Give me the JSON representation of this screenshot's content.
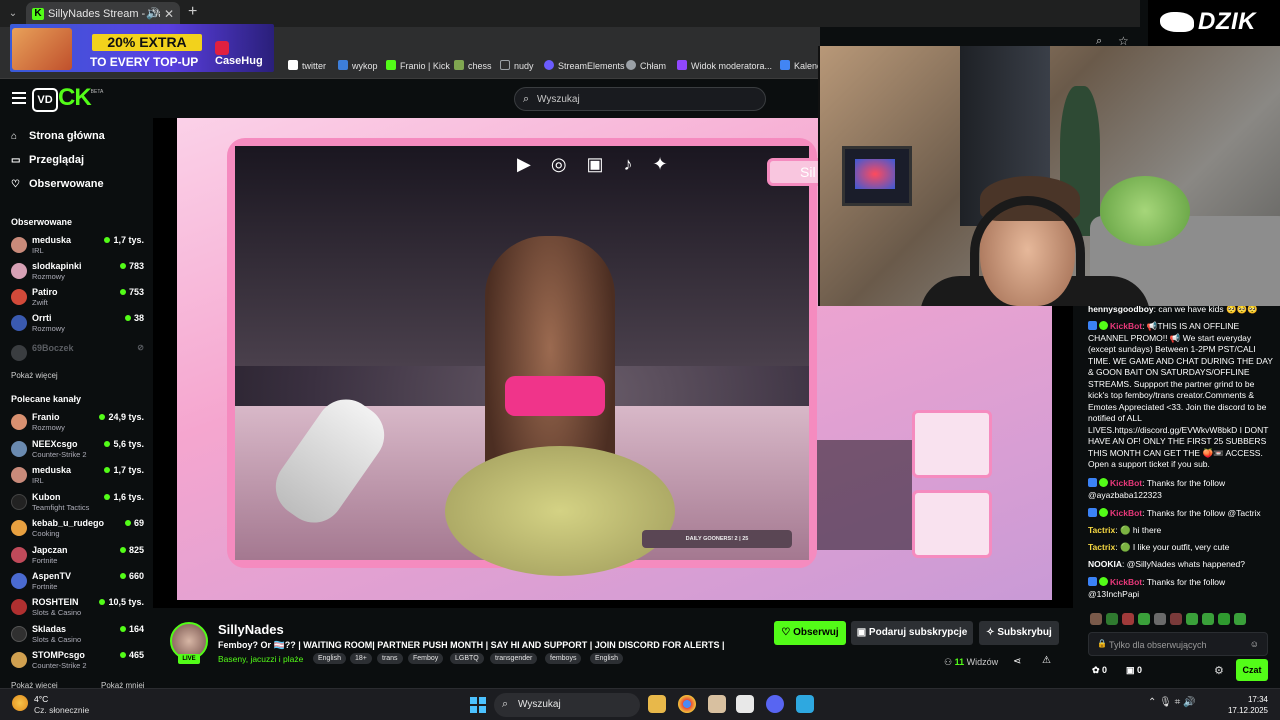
{
  "browser": {
    "tab_title": "SillyNades Stream - Watch L",
    "bookmarks": [
      {
        "label": "twitter",
        "color": "#ffffff"
      },
      {
        "label": "wykop",
        "color": "#3d7ed9"
      },
      {
        "label": "Franio | Kick",
        "color": "#53fc18"
      },
      {
        "label": "chess",
        "color": "#7fa650"
      },
      {
        "label": "nudy",
        "color": "#9aa0a6"
      },
      {
        "label": "StreamElements",
        "color": "#6b5cff"
      },
      {
        "label": "Chłam",
        "color": "#9aa0a6"
      },
      {
        "label": "Widok moderatora...",
        "color": "#9147ff"
      },
      {
        "label": "Kalend",
        "color": "#4285f4"
      }
    ]
  },
  "ad": {
    "headline": "20% EXTRA",
    "subline": "TO EVERY TOP-UP",
    "brand": "CaseHug"
  },
  "header": {
    "logo_badge": "VD",
    "logo_text": "CK",
    "beta": "BETA",
    "search_placeholder": "Wyszukaj"
  },
  "sidebar": {
    "nav": [
      {
        "label": "Strona główna",
        "icon": "home-icon"
      },
      {
        "label": "Przeglądaj",
        "icon": "browse-icon"
      },
      {
        "label": "Obserwowane",
        "icon": "heart-icon"
      }
    ],
    "followed_title": "Obserwowane",
    "followed": [
      {
        "name": "meduska",
        "category": "IRL",
        "viewers": "1,7 tys.",
        "color": "#c98a7a"
      },
      {
        "name": "slodkapinki",
        "category": "Rozmowy",
        "viewers": "783",
        "color": "#d6a0b4"
      },
      {
        "name": "Patiro",
        "category": "Zwift",
        "viewers": "753",
        "color": "#d24a3a"
      },
      {
        "name": "Orrti",
        "category": "Rozmowy",
        "viewers": "38",
        "color": "#3a5ab0"
      },
      {
        "name": "69Boczek",
        "category": "",
        "viewers": "",
        "color": "#3a3d40"
      }
    ],
    "show_more": "Pokaż więcej",
    "recommended_title": "Polecane kanały",
    "recommended": [
      {
        "name": "Franio",
        "category": "Rozmowy",
        "viewers": "24,9 tys.",
        "color": "#d89070"
      },
      {
        "name": "NEEXcsgo",
        "category": "Counter-Strike 2",
        "viewers": "5,6 tys.",
        "color": "#6a8ab0"
      },
      {
        "name": "meduska",
        "category": "IRL",
        "viewers": "1,7 tys.",
        "color": "#c98a7a"
      },
      {
        "name": "Kubon",
        "category": "Teamfight Tactics",
        "viewers": "1,6 tys.",
        "color": "#222222"
      },
      {
        "name": "kebab_u_rudego",
        "category": "Cooking",
        "viewers": "69",
        "color": "#e8a040"
      },
      {
        "name": "Japczan",
        "category": "Fortnite",
        "viewers": "825",
        "color": "#c04a5a"
      },
      {
        "name": "AspenTV",
        "category": "Fortnite",
        "viewers": "660",
        "color": "#4a6ad0"
      },
      {
        "name": "ROSHTEIN",
        "category": "Slots & Casino",
        "viewers": "10,5 tys.",
        "color": "#b03030"
      },
      {
        "name": "Skladas",
        "category": "Slots & Casino",
        "viewers": "164",
        "color": "#303030"
      },
      {
        "name": "STOMPcsgo",
        "category": "Counter-Strike 2",
        "viewers": "465",
        "color": "#d0a050"
      }
    ],
    "footer_more": "Pokaż więcej",
    "footer_less": "Pokaż mniej"
  },
  "video_overlay": {
    "daily_goal": "DAILY GOONERS!    2 | 25",
    "side_label": "Sil"
  },
  "stream": {
    "live": "LIVE",
    "name": "SillyNades",
    "title": "Femboy? Or 🏳️‍⚧️?? | WAITING ROOM|  PARTNER PUSH  MONTH | SAY HI AND SUPPORT | JOIN DISCORD FOR ALERTS |",
    "category": "Baseny, jacuzzi i plaże",
    "tags": [
      "English",
      "18+",
      "trans",
      "Femboy",
      "LGBTQ",
      "transgender",
      "femboys",
      "English"
    ],
    "follow_label": "Obserwuj",
    "gift_label": "Podaruj subskrypcje",
    "subscribe_label": "Subskrybuj",
    "viewer_count": "11",
    "viewer_label": "Widzów"
  },
  "chat": {
    "messages": [
      {
        "user": "hennysgoodboy",
        "user_color": "#ffffff",
        "text": "can we have kids 🥺🥺🥺",
        "badges": []
      },
      {
        "user": "KickBot",
        "user_color": "#e8387a",
        "text": "📢THIS IS AN OFFLINE CHANNEL PROMO!! 📢 We start everyday (except sundays) Between 1-2PM PST/CALI TIME. WE GAME AND CHAT DURING THE DAY & GOON BAIT ON SATURDAYS/OFFLINE STREAMS. Suppport the partner grind to be kick's top femboy/trans creator.Comments & Emotes Appreciated <33. Join the discord to be notified of ALL LIVES.https://discord.gg/EVWkvW8bkD I DONT HAVE AN OF! ONLY THE FIRST 25 SUBBERS THIS MONTH CAN GET THE 🍑📼 ACCESS. Open a support ticket if you sub.",
        "badges": [
          "#3b82f6",
          "#53fc18"
        ]
      },
      {
        "user": "KickBot",
        "user_color": "#e8387a",
        "text": "Thanks for the follow @ayazbaba122323",
        "badges": [
          "#3b82f6",
          "#53fc18"
        ]
      },
      {
        "user": "KickBot",
        "user_color": "#e8387a",
        "text": "Thanks for the follow @Tactrix",
        "badges": [
          "#3b82f6",
          "#53fc18"
        ]
      },
      {
        "user": "Tactrix",
        "user_color": "#f5d742",
        "text": "🟢 hi there",
        "badges": []
      },
      {
        "user": "Tactrix",
        "user_color": "#f5d742",
        "text": "🟢 I like your outfit, very cute",
        "badges": []
      },
      {
        "user": "NOOKIA",
        "user_color": "#ffffff",
        "text": "@SillyNades whats happened?",
        "badges": []
      },
      {
        "user": "KickBot",
        "user_color": "#e8387a",
        "text": "Thanks for the follow @13InchPapi",
        "badges": [
          "#3b82f6",
          "#53fc18"
        ]
      }
    ],
    "input_placeholder": "Tylko dla obserwujących",
    "points": "0",
    "gifts": "0",
    "send_label": "Czat"
  },
  "webcam": {
    "brand": "DZIK"
  },
  "taskbar": {
    "temperature": "4°C",
    "condition": "Cz. słonecznie",
    "search_label": "Wyszukaj",
    "time": "17:34",
    "date": "17.12.2025"
  }
}
